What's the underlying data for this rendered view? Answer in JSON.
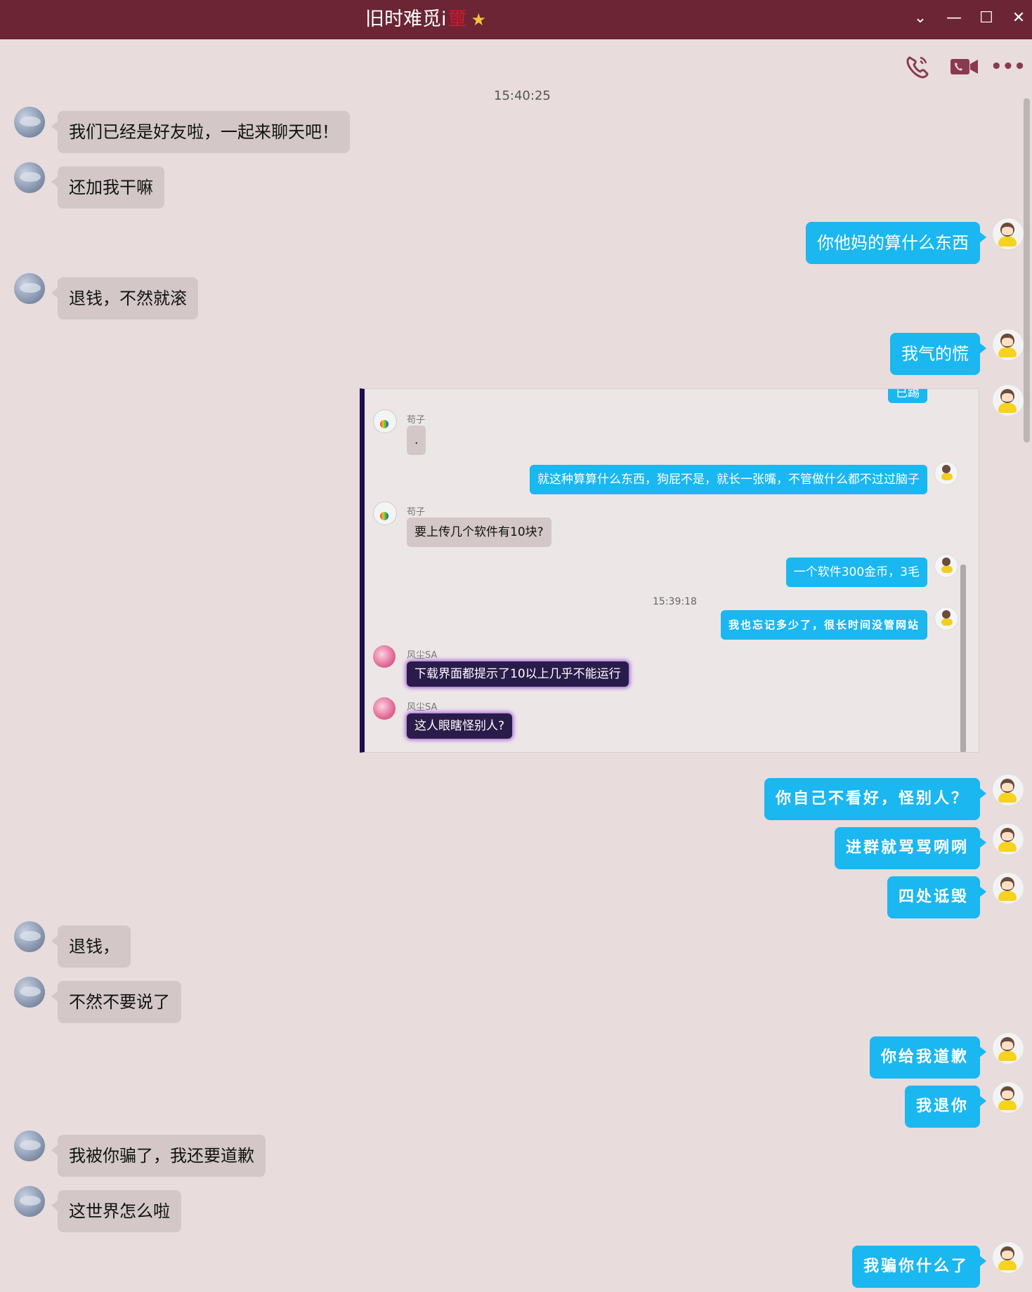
{
  "window": {
    "title": "旧时难觅i",
    "title_deco": "壐",
    "title_star": "★",
    "buttons": [
      "⌄",
      "—",
      "☐",
      "✕"
    ]
  },
  "toolbar": {
    "icons": [
      "phone-icon",
      "video-icon",
      "more-icon"
    ],
    "more_label": "•••"
  },
  "timestamp": "15:40:25",
  "messages": [
    {
      "side": "left",
      "text": "我们已经是好友啦，一起来聊天吧！"
    },
    {
      "side": "left",
      "text": "还加我干嘛"
    },
    {
      "side": "right",
      "text": "你他妈的算什么东西"
    },
    {
      "side": "left",
      "text": "退钱，不然就滚"
    },
    {
      "side": "right",
      "text": "我气的慌"
    },
    {
      "side": "right",
      "text": "你自己不看好，怪别人？"
    },
    {
      "side": "right",
      "text": "进群就骂骂咧咧"
    },
    {
      "side": "right",
      "text": "四处诋毁"
    },
    {
      "side": "left",
      "text": "退钱，"
    },
    {
      "side": "left",
      "text": "不然不要说了"
    },
    {
      "side": "right",
      "text": "你给我道歉"
    },
    {
      "side": "right",
      "text": "我退你"
    },
    {
      "side": "left",
      "text": "我被你骗了，我还要道歉"
    },
    {
      "side": "left",
      "text": "这世界怎么啦"
    },
    {
      "side": "right",
      "text": "我骗你什么了"
    }
  ],
  "screenshot": {
    "top_partial": "已踢",
    "time": "15:39:18",
    "items": [
      {
        "sender": "苟子",
        "text": "."
      },
      {
        "side": "right",
        "text": "就这种算算什么东西，狗屁不是，就长一张嘴，不管做什么都不过过脑子"
      },
      {
        "sender": "苟子",
        "text": "要上传几个软件有10块?"
      },
      {
        "side": "right",
        "text": "一个软件300金币，3毛"
      },
      {
        "side": "right",
        "text": "我也忘记多少了，很长时间没管网站"
      },
      {
        "sender": "风尘SA",
        "text": "下载界面都提示了10以上几乎不能运行"
      },
      {
        "sender": "风尘SA",
        "text": "这人眼瞎怪别人?"
      }
    ]
  }
}
